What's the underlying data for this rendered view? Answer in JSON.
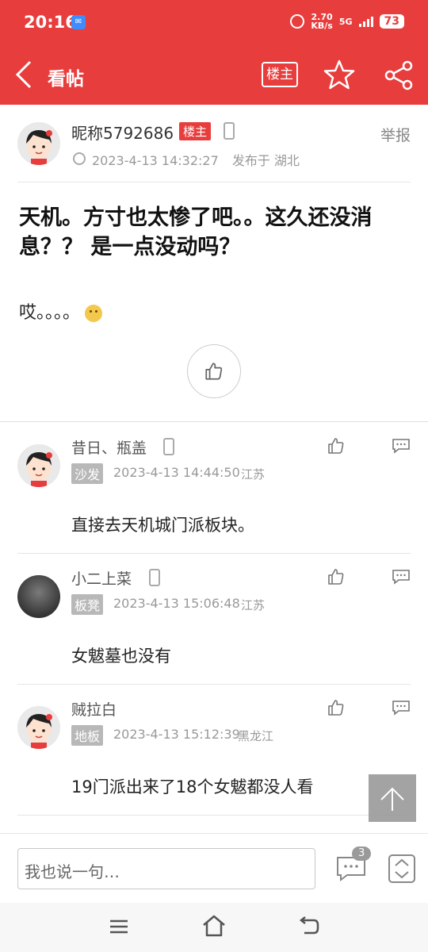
{
  "status_bar": {
    "time": "20:16",
    "net_speed_value": "2.70",
    "net_speed_unit": "KB/s",
    "network": "5G",
    "battery": "73",
    "app_icon": "notification-app-icon"
  },
  "nav": {
    "title": "看帖",
    "owner_button": "楼主",
    "icons": [
      "back-icon",
      "star-icon",
      "share-icon"
    ]
  },
  "post": {
    "author": "昵称5792686",
    "owner_tag": "楼主",
    "report": "举报",
    "time": "2023-4-13 14:32:27",
    "location": "发布于 湖北",
    "title": "天机。方寸也太惨了吧。。这久还没消息？？ 是一点没动吗？",
    "body": "哎。。。。"
  },
  "replies": [
    {
      "name": "昔日、瓶盖",
      "floor": "沙发",
      "time": "2023-4-13 14:44:50",
      "location": "江苏",
      "text": "直接去天机城门派板块。"
    },
    {
      "name": "小二上菜",
      "floor": "板凳",
      "time": "2023-4-13 15:06:48",
      "location": "江苏",
      "text": "女魃墓也没有"
    },
    {
      "name": "贼拉白",
      "floor": "地板",
      "time": "2023-4-13 15:12:39",
      "location": "黑龙江",
      "text": "19门派出来了18个女魃都没人看"
    }
  ],
  "bottom_bar": {
    "input_placeholder": "我也说一句…",
    "comment_count": "3"
  },
  "colors": {
    "brand_red": "#e83d3d",
    "tag_gray": "#b8b8b8"
  }
}
